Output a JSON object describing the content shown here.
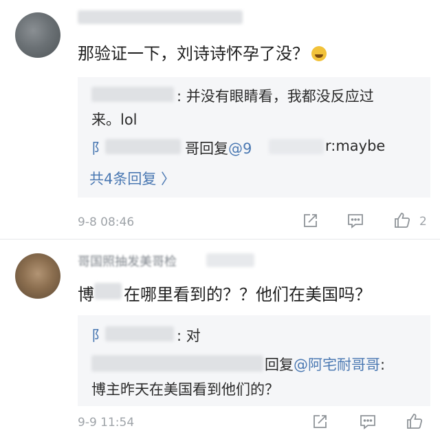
{
  "comments": [
    {
      "body": "那验证一下，刘诗诗怀孕了没？",
      "emoji": "laughing-tears-emoji",
      "replies": [
        {
          "text1": ": 并没有眼睛看，我都没反应过",
          "text2": "来。lol"
        },
        {
          "prefix": "阝",
          "mid": "哥回复",
          "link": "@9",
          "suffix": "r:maybe"
        }
      ],
      "more_replies": "共4条回复 〉",
      "timestamp": "9-8 08:46",
      "like_count": "2"
    },
    {
      "username_partial": "哥国照抽发美哥检",
      "body_prefix": "博",
      "body": "在哪里看到的？？他们在美国吗？",
      "replies": [
        {
          "prefix": "阝",
          "text": ": 对"
        },
        {
          "mid": "回复",
          "link": "@阿宅耐哥哥",
          "suffix": ":",
          "line2": "博主昨天在美国看到他们的？"
        }
      ],
      "timestamp": "9-9 11:54",
      "like_count": ""
    }
  ]
}
